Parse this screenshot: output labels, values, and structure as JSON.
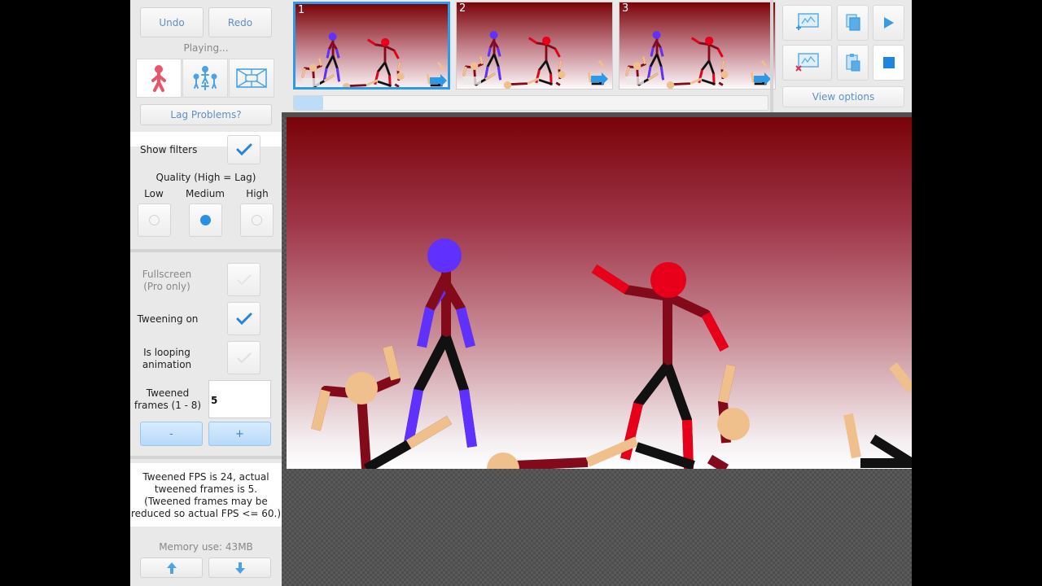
{
  "history": {
    "undo_label": "Undo",
    "redo_label": "Redo",
    "status": "Playing..."
  },
  "mode_tabs": [
    {
      "icon": "stick-figure-icon",
      "active": true
    },
    {
      "icon": "add-figures-icon",
      "active": false
    },
    {
      "icon": "background-icon",
      "active": false
    }
  ],
  "lag_problems_label": "Lag Problems?",
  "filters": {
    "show_filters_label": "Show filters",
    "show_filters_checked": true,
    "quality_label": "Quality (High = Lag)",
    "quality_options": [
      "Low",
      "Medium",
      "High"
    ],
    "quality_selected": "Medium"
  },
  "settings": {
    "fullscreen_label_1": "Fullscreen",
    "fullscreen_label_2": "(Pro only)",
    "tweening_label": "Tweening on",
    "tweening_checked": true,
    "looping_label_1": "Is looping",
    "looping_label_2": "animation",
    "tweened_frames_label_1": "Tweened",
    "tweened_frames_label_2": "frames (1 - 8)",
    "tweened_frames_value": "5",
    "minus_label": "-",
    "plus_label": "+"
  },
  "fps_info": {
    "line1": "Tweened FPS is 24, actual",
    "line2": "tweened frames is 5.",
    "line3": "(Tweened frames may be",
    "line4": "reduced so actual FPS <= 60.)"
  },
  "memory": {
    "label": "Memory use: 43MB"
  },
  "frames": [
    {
      "number": "1",
      "selected": true
    },
    {
      "number": "2",
      "selected": false
    },
    {
      "number": "3",
      "selected": false
    }
  ],
  "timeline_scroll": 0.06,
  "toolbar": {
    "view_options_label": "View options"
  },
  "colors": {
    "accent": "#2b9ae8",
    "panel": "#e9e9e9",
    "link_blue": "#5f8fc8",
    "figure_blue": "#6030ff",
    "figure_red": "#e8001a",
    "dark_red": "#820a1a",
    "skin": "#f0c08c"
  }
}
